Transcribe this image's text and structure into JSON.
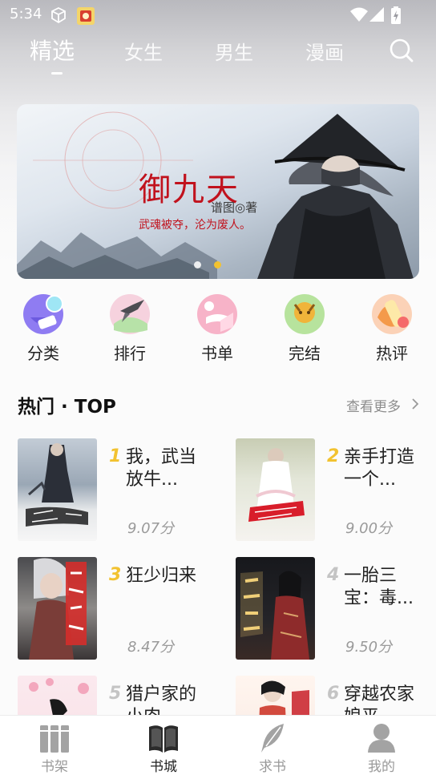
{
  "status_bar": {
    "time": "5:34"
  },
  "top_tabs": [
    {
      "label": "精选",
      "active": true
    },
    {
      "label": "女生",
      "active": false
    },
    {
      "label": "男生",
      "active": false
    },
    {
      "label": "漫画",
      "active": false
    }
  ],
  "banner": {
    "title": "御九天",
    "author": "谱图◎著",
    "tagline": "武魂被夺，沦为废人。",
    "active_dot_index": 1,
    "dot_count": 2
  },
  "quick_nav": [
    {
      "label": "分类",
      "icon": "category-icon"
    },
    {
      "label": "排行",
      "icon": "ranking-icon"
    },
    {
      "label": "书单",
      "icon": "booklist-icon"
    },
    {
      "label": "完结",
      "icon": "completed-icon"
    },
    {
      "label": "热评",
      "icon": "hot-review-icon"
    }
  ],
  "hot_section": {
    "title": "热门 · TOP",
    "see_more": "查看更多"
  },
  "books": [
    {
      "rank": "1",
      "title": "我，武当放牛...",
      "score": "9.07分"
    },
    {
      "rank": "2",
      "title": "亲手打造一个...",
      "score": "9.00分"
    },
    {
      "rank": "3",
      "title": "狂少归来",
      "score": "8.47分"
    },
    {
      "rank": "4",
      "title": "一胎三宝：毒...",
      "score": "9.50分"
    },
    {
      "rank": "5",
      "title": "猎户家的小肉",
      "score": ""
    },
    {
      "rank": "6",
      "title": "穿越农家娘平",
      "score": ""
    }
  ],
  "colors": {
    "rank_top3": "#f2c230",
    "rank_other": "#c4c4c4",
    "active_dot": "#f2c230",
    "accent_red": "#c1121d"
  },
  "bottom_nav": [
    {
      "label": "书架",
      "icon": "bookshelf-icon",
      "active": false
    },
    {
      "label": "书城",
      "icon": "bookstore-icon",
      "active": true
    },
    {
      "label": "求书",
      "icon": "request-book-icon",
      "active": false
    },
    {
      "label": "我的",
      "icon": "profile-icon",
      "active": false
    }
  ]
}
